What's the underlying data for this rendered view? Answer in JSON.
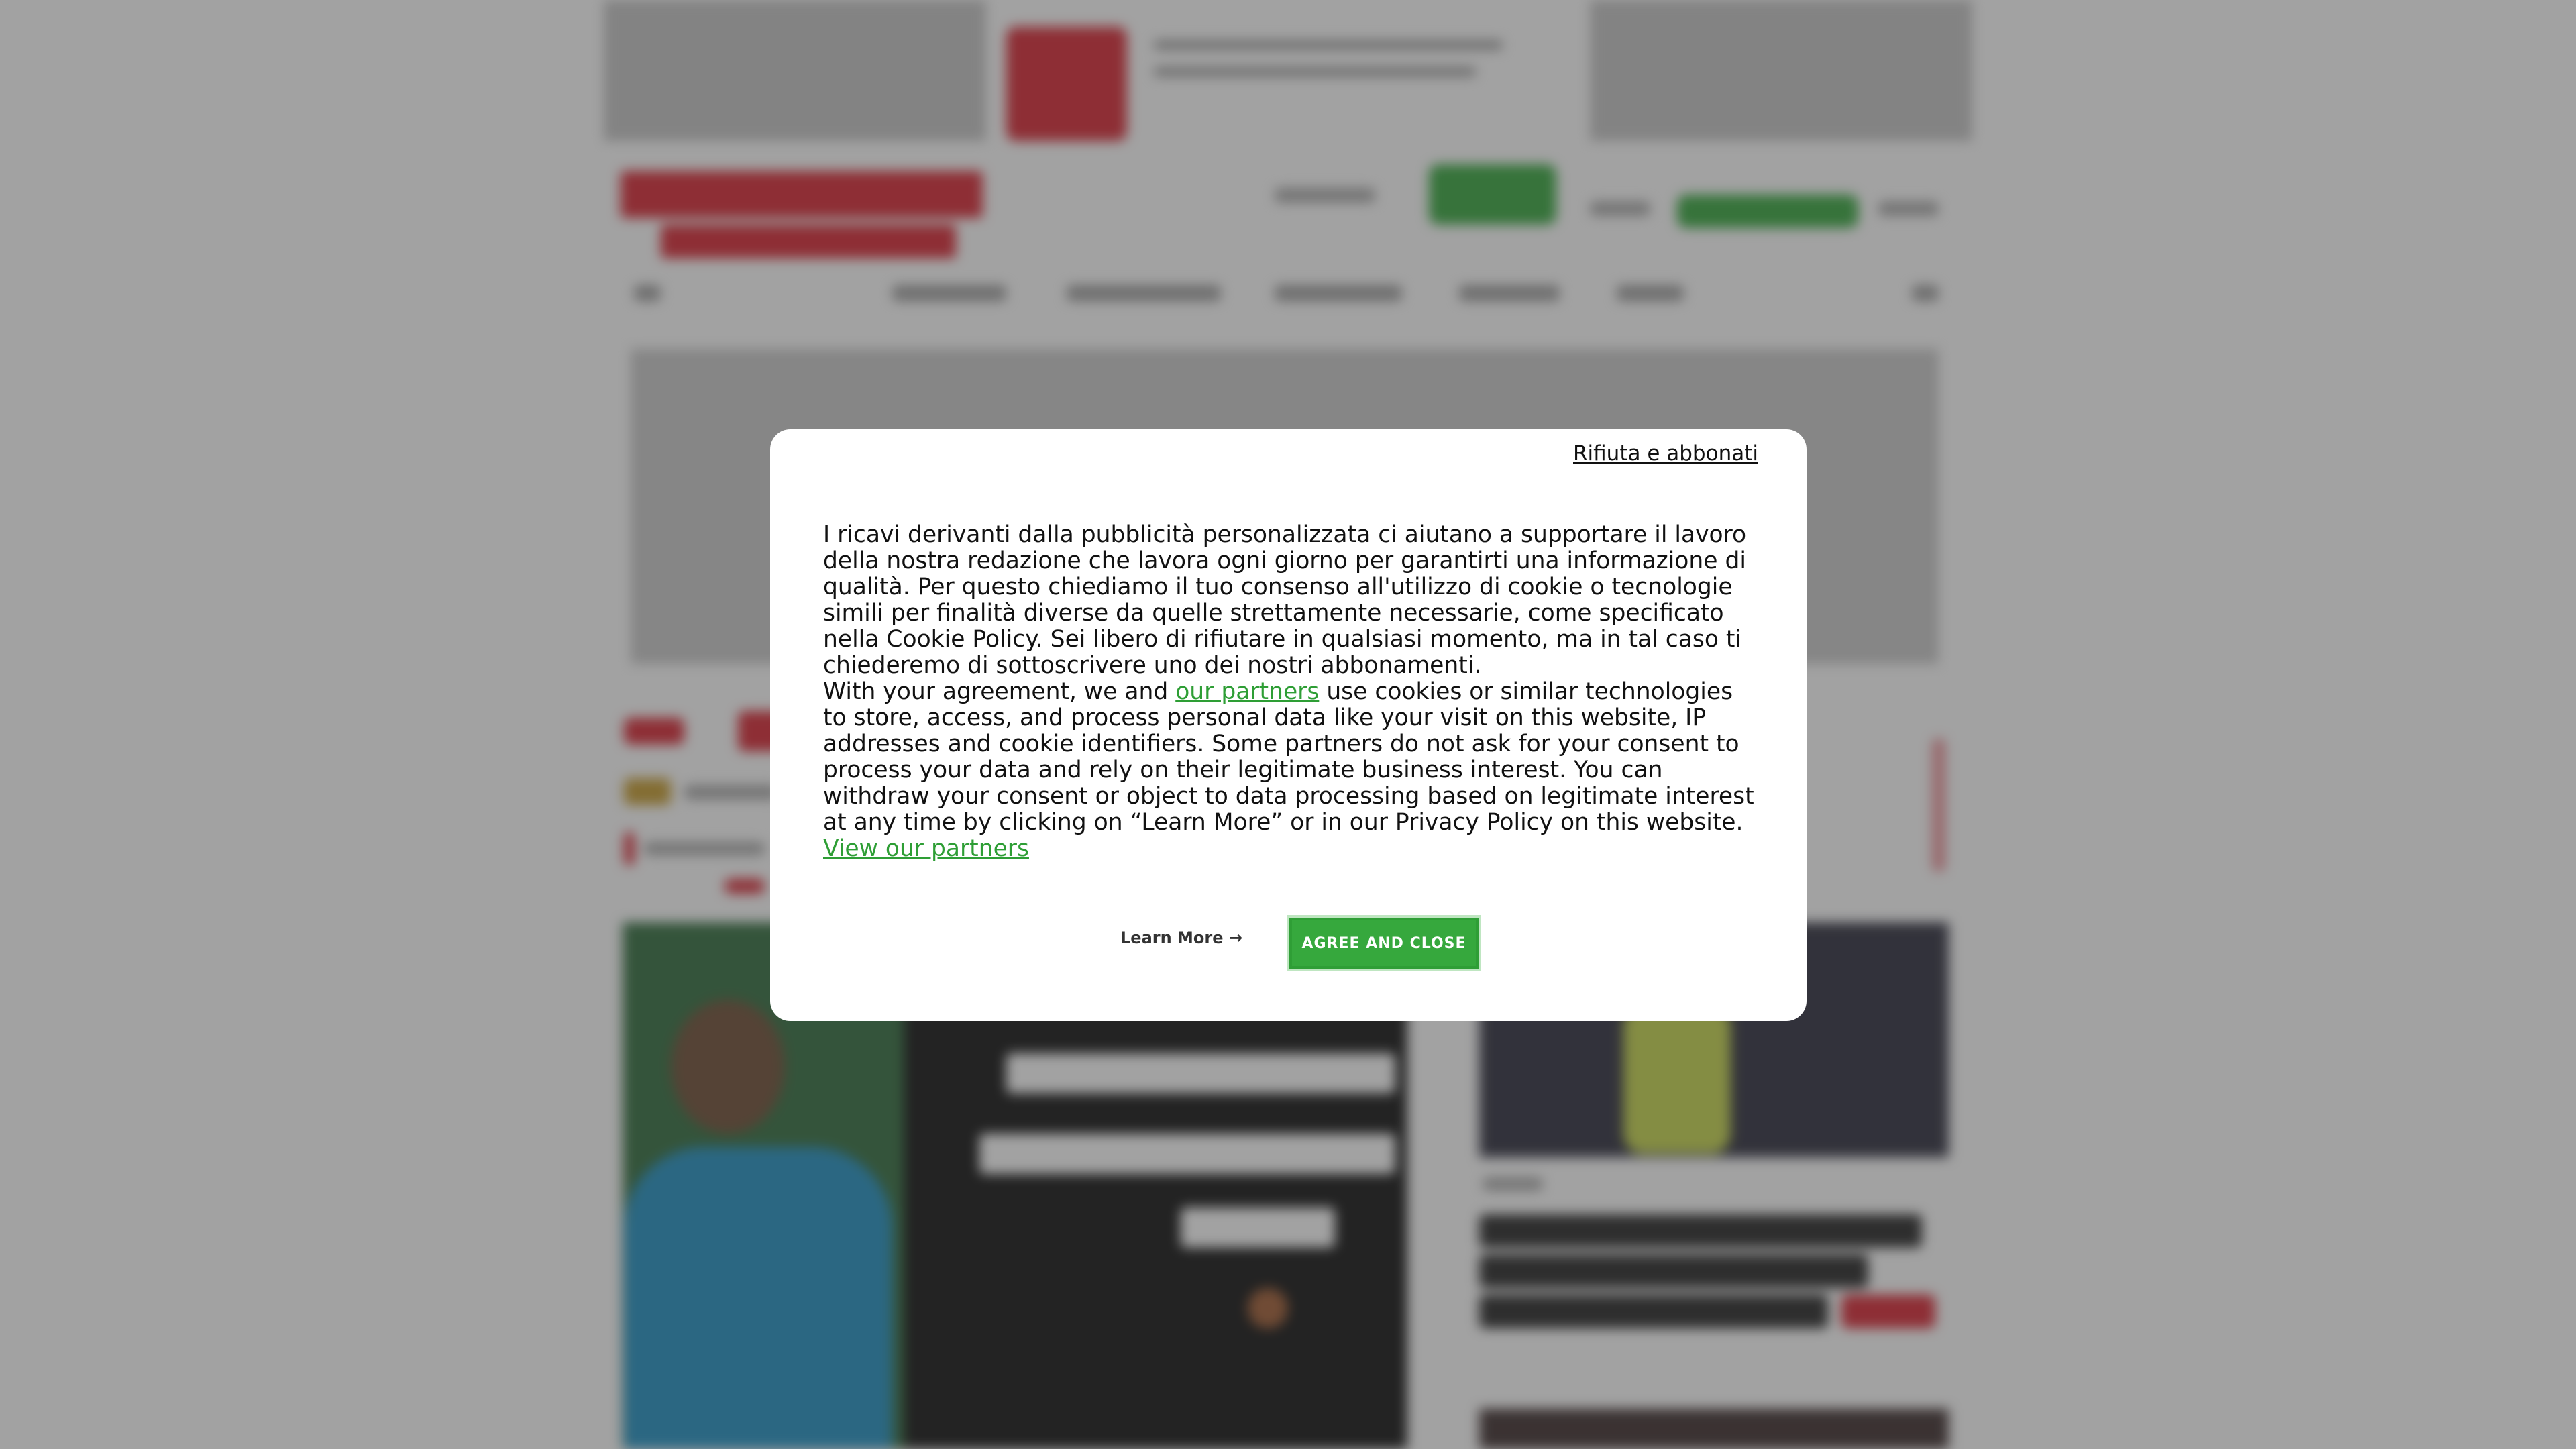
{
  "dialog": {
    "reject_link": "Rifiuta e abbonati",
    "paragraph_it": "I ricavi derivanti dalla pubblicità personalizzata ci aiutano a supportare il lavoro della nostra redazione che lavora ogni giorno per garantirti una informazione di qualità. Per questo chiediamo il tuo consenso all'utilizzo di cookie o tecnologie simili per finalità diverse da quelle strettamente necessarie, come specificato nella Cookie Policy. Sei libero di rifiutare in qualsiasi momento, ma in tal caso ti chiederemo di sottoscrivere uno dei nostri abbonamenti.",
    "paragraph_en_before": "With your agreement, we and",
    "partners_link": "our partners",
    "paragraph_en_after": "use cookies or similar technologies to store, access, and process personal data like your visit on this website, IP addresses and cookie identifiers. Some partners do not ask for your consent to process your data and rely on their legitimate business interest. You can withdraw your consent or object to data processing based on legitimate interest at any time by clicking on “Learn More” or in our Privacy Policy on this website.",
    "view_partners_link": "View our partners",
    "learn_more_button": "Learn More →",
    "agree_button": "AGREE AND CLOSE"
  },
  "colors": {
    "accent_green": "#36a83d",
    "brand_red": "#d8222f",
    "overlay": "rgba(60,60,60,0.48)"
  }
}
